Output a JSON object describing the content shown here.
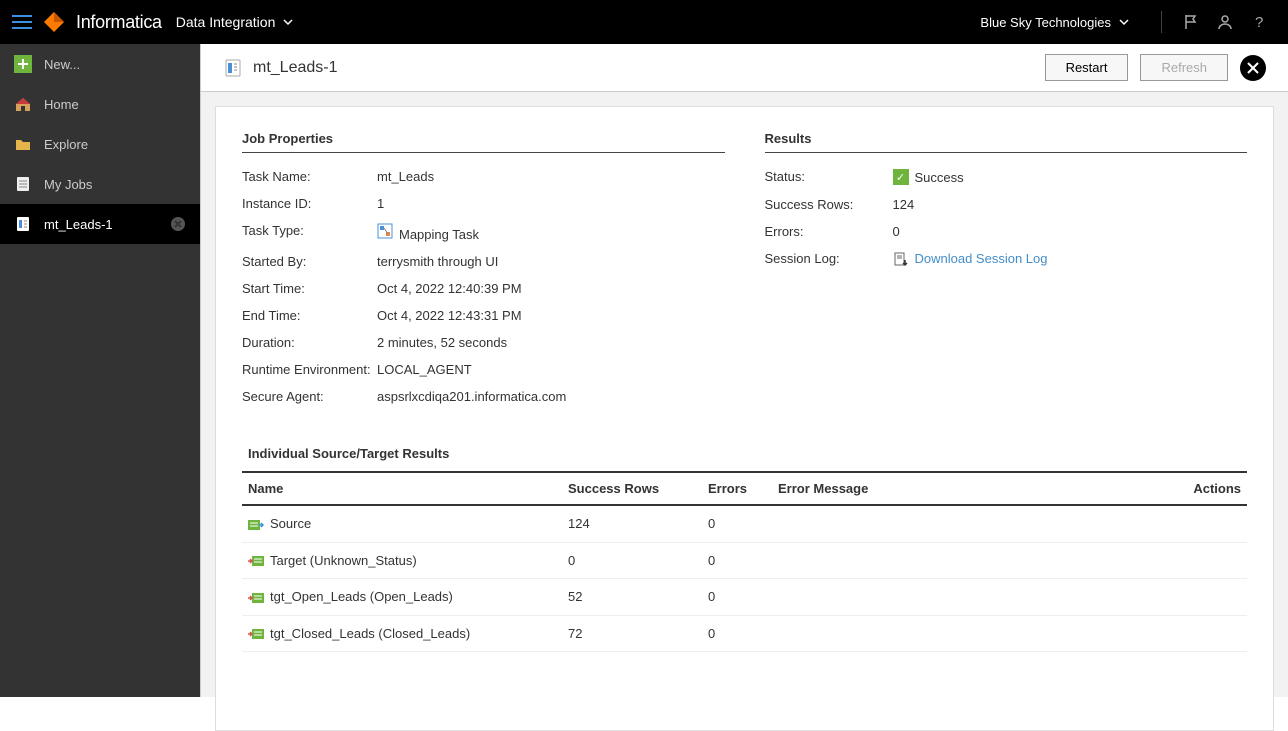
{
  "header": {
    "brand": "Informatica",
    "app": "Data Integration",
    "org": "Blue Sky Technologies"
  },
  "sidebar": {
    "items": [
      {
        "label": "New...",
        "icon": "new"
      },
      {
        "label": "Home",
        "icon": "home"
      },
      {
        "label": "Explore",
        "icon": "explore"
      },
      {
        "label": "My Jobs",
        "icon": "jobs"
      },
      {
        "label": "mt_Leads-1",
        "icon": "doc",
        "active": true,
        "closable": true
      }
    ]
  },
  "page": {
    "title": "mt_Leads-1",
    "actions": {
      "restart": "Restart",
      "refresh": "Refresh"
    }
  },
  "job": {
    "section_title": "Job Properties",
    "task_name": "mt_Leads",
    "instance_id": "1",
    "task_type": "Mapping Task",
    "started_by": "terrysmith through UI",
    "start_time": "Oct 4, 2022 12:40:39 PM",
    "end_time": "Oct 4, 2022 12:43:31 PM",
    "duration": "2 minutes, 52 seconds",
    "runtime_env": "LOCAL_AGENT",
    "secure_agent": "aspsrlxcdiqa201.informatica.com",
    "labels": {
      "task_name": "Task Name:",
      "instance_id": "Instance ID:",
      "task_type": "Task Type:",
      "started_by": "Started By:",
      "start_time": "Start Time:",
      "end_time": "End Time:",
      "duration": "Duration:",
      "runtime_env": "Runtime Environment:",
      "secure_agent": "Secure Agent:"
    }
  },
  "results": {
    "section_title": "Results",
    "status": "Success",
    "success_rows": "124",
    "errors": "0",
    "session_log": "Download Session Log",
    "labels": {
      "status": "Status:",
      "success_rows": "Success Rows:",
      "errors": "Errors:",
      "session_log": "Session Log:"
    }
  },
  "table": {
    "title": "Individual Source/Target Results",
    "headers": {
      "name": "Name",
      "success": "Success Rows",
      "errors": "Errors",
      "errmsg": "Error Message",
      "actions": "Actions"
    },
    "rows": [
      {
        "icon": "source",
        "name": "Source",
        "success": "124",
        "errors": "0",
        "errmsg": ""
      },
      {
        "icon": "target",
        "name": "Target (Unknown_Status)",
        "success": "0",
        "errors": "0",
        "errmsg": ""
      },
      {
        "icon": "target",
        "name": "tgt_Open_Leads (Open_Leads)",
        "success": "52",
        "errors": "0",
        "errmsg": ""
      },
      {
        "icon": "target",
        "name": "tgt_Closed_Leads (Closed_Leads)",
        "success": "72",
        "errors": "0",
        "errmsg": ""
      }
    ]
  }
}
